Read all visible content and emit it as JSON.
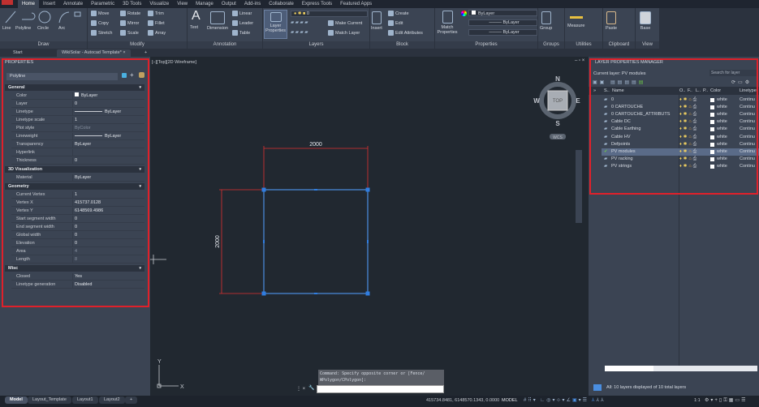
{
  "menu": [
    "Home",
    "Insert",
    "Annotate",
    "Parametric",
    "3D Tools",
    "Visualize",
    "View",
    "Manage",
    "Output",
    "Add-ins",
    "Collaborate",
    "Express Tools",
    "Featured Apps"
  ],
  "ribbon": {
    "draw": {
      "title": "Draw",
      "line": "Line",
      "polyline": "Polyline",
      "circle": "Circle",
      "arc": "Arc"
    },
    "modify": {
      "title": "Modify",
      "move": "Move",
      "rotate": "Rotate",
      "trim": "Trim",
      "copy": "Copy",
      "mirror": "Mirror",
      "fillet": "Fillet",
      "stretch": "Stretch",
      "scale": "Scale",
      "array": "Array"
    },
    "annotation": {
      "title": "Annotation",
      "text": "Text",
      "dimension": "Dimension",
      "linear": "Linear",
      "leader": "Leader",
      "table": "Table"
    },
    "layers": {
      "title": "Layers",
      "layer_properties": "Layer Properties",
      "current_layer": "0",
      "make_current": "Make Current",
      "match_layer": "Match Layer"
    },
    "block": {
      "title": "Block",
      "insert": "Insert",
      "create": "Create",
      "edit": "Edit",
      "edit_attributes": "Edit Attributes"
    },
    "properties": {
      "title": "Properties",
      "match_properties": "Match Properties",
      "color": "ByLayer",
      "lineweight": "ByLayer",
      "linetype": "ByLayer"
    },
    "groups": {
      "title": "Groups",
      "group": "Group"
    },
    "utilities": {
      "title": "Utilities",
      "measure": "Measure"
    },
    "clipboard": {
      "title": "Clipboard",
      "paste": "Paste"
    },
    "view": {
      "title": "View",
      "base": "Base"
    }
  },
  "file_tabs": {
    "start": "Start",
    "doc": "WikiSolar - Autocad Template*",
    "close": "×",
    "add": "+"
  },
  "properties_panel": {
    "title": "PROPERTIES",
    "selection": "Polyline",
    "general": {
      "title": "General",
      "rows": [
        {
          "k": "Color",
          "v": "ByLayer"
        },
        {
          "k": "Layer",
          "v": "0"
        },
        {
          "k": "Linetype",
          "v": "ByLayer"
        },
        {
          "k": "Linetype scale",
          "v": "1"
        },
        {
          "k": "Plot style",
          "v": "ByColor"
        },
        {
          "k": "Lineweight",
          "v": "ByLayer"
        },
        {
          "k": "Transparency",
          "v": "ByLayer"
        },
        {
          "k": "Hyperlink",
          "v": ""
        },
        {
          "k": "Thickness",
          "v": "0"
        }
      ]
    },
    "viz": {
      "title": "3D Visualization",
      "rows": [
        {
          "k": "Material",
          "v": "ByLayer"
        }
      ]
    },
    "geometry": {
      "title": "Geometry",
      "rows": [
        {
          "k": "Current Vertex",
          "v": "1"
        },
        {
          "k": "Vertex X",
          "v": "415737.0128"
        },
        {
          "k": "Vertex Y",
          "v": "6148569.4986"
        },
        {
          "k": "Start segment width",
          "v": "0"
        },
        {
          "k": "End segment width",
          "v": "0"
        },
        {
          "k": "Global width",
          "v": "0"
        },
        {
          "k": "Elevation",
          "v": "0"
        },
        {
          "k": "Area",
          "v": "4"
        },
        {
          "k": "Length",
          "v": "8"
        }
      ]
    },
    "misc": {
      "title": "Misc",
      "rows": [
        {
          "k": "Closed",
          "v": "Yes"
        },
        {
          "k": "Linetype generation",
          "v": "Disabled"
        }
      ]
    }
  },
  "viewport": {
    "label": "[–][Top][2D Wireframe]",
    "dim_h": "2000",
    "dim_v": "2000",
    "compass": {
      "n": "N",
      "s": "S",
      "e": "E",
      "w": "W",
      "top": "TOP",
      "wcs": "WCS"
    },
    "ucs_x": "X",
    "ucs_y": "Y"
  },
  "command": {
    "history_1": "Command: Specify opposite corner or [Fence/",
    "history_2": "WPolygon/CPolygon]:",
    "input": ""
  },
  "layer_manager": {
    "title": "LAYER PROPERTIES MANAGER",
    "current": "Current layer: PV modules",
    "search_placeholder": "Search for layer",
    "headers": {
      "s": "S..",
      "name": "Name",
      "o": "O..",
      "f": "F..",
      "l": "L..",
      "p": "P..",
      "color": "Color",
      "linetype": "Linetype"
    },
    "layers": [
      {
        "name": "0",
        "color": "white",
        "linetype": "Continu"
      },
      {
        "name": "0 CARTOUCHE",
        "color": "white",
        "linetype": "Continu"
      },
      {
        "name": "0 CARTOUCHE_ATTRIBUTS",
        "color": "white",
        "linetype": "Continu"
      },
      {
        "name": "Cable DC",
        "color": "white",
        "linetype": "Continu"
      },
      {
        "name": "Cable Earthing",
        "color": "white",
        "linetype": "Continu"
      },
      {
        "name": "Cable HV",
        "color": "white",
        "linetype": "Continu"
      },
      {
        "name": "Defpoints",
        "color": "white",
        "linetype": "Continu"
      },
      {
        "name": "PV modules",
        "color": "white",
        "linetype": "Continu"
      },
      {
        "name": "PV racking",
        "color": "white",
        "linetype": "Continu"
      },
      {
        "name": "PV strings",
        "color": "white",
        "linetype": "Continu"
      }
    ],
    "footer": "All: 10 layers displayed of 10 total layers"
  },
  "layout_tabs": [
    "Model",
    "Layout_Template",
    "Layout1",
    "Layout2"
  ],
  "status": {
    "coords": "415734.8481, 6148570.1343, 0.0000",
    "model": "MODEL",
    "scale": "1:1"
  }
}
